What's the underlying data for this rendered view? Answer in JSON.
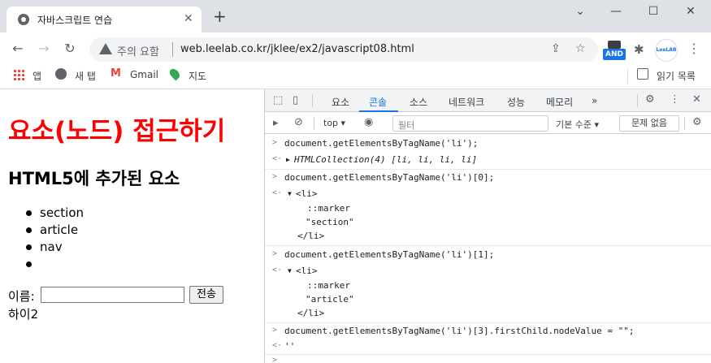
{
  "browser": {
    "tab_title": "자바스크립트 연습",
    "security_label": "주의 요함",
    "url": "web.leelab.co.kr/jklee/ex2/javascript08.html",
    "ext_and_label": "AND",
    "ext_leelab_label": "LeeLAB"
  },
  "bookmarks": {
    "items": [
      {
        "label": "앱"
      },
      {
        "label": "새 탭"
      },
      {
        "label": "Gmail"
      },
      {
        "label": "지도"
      }
    ],
    "reading_list": "읽기 목록"
  },
  "page": {
    "heading1": "요소(노드) 접근하기",
    "heading2": "HTML5에 추가된 요소",
    "list_items": [
      "section",
      "article",
      "nav",
      ""
    ],
    "form_label": "이름:",
    "input_value": "",
    "submit_label": "전송",
    "output_text": "하이2"
  },
  "devtools": {
    "tabs": [
      "요소",
      "콘솔",
      "소스",
      "네트워크",
      "성능",
      "메모리"
    ],
    "active_tab": "콘솔",
    "more_tabs": "»",
    "context": "top",
    "filter_placeholder": "필터",
    "levels_label": "기본 수준",
    "issues_label": "문제 없음",
    "console": {
      "cmd1": "document.getElementsByTagName('li');",
      "res1": "HTMLCollection(4) [li, li, li, li]",
      "cmd2": "document.getElementsByTagName('li')[0];",
      "res2_open": "<li>",
      "res2_marker": "::marker",
      "res2_text": "\"section\"",
      "res2_close": "</li>",
      "cmd3": "document.getElementsByTagName('li')[1];",
      "res3_open": "<li>",
      "res3_marker": "::marker",
      "res3_text": "\"article\"",
      "res3_close": "</li>",
      "cmd4": "document.getElementsByTagName('li')[3].firstChild.nodeValue = \"\";",
      "res4": "''"
    }
  }
}
